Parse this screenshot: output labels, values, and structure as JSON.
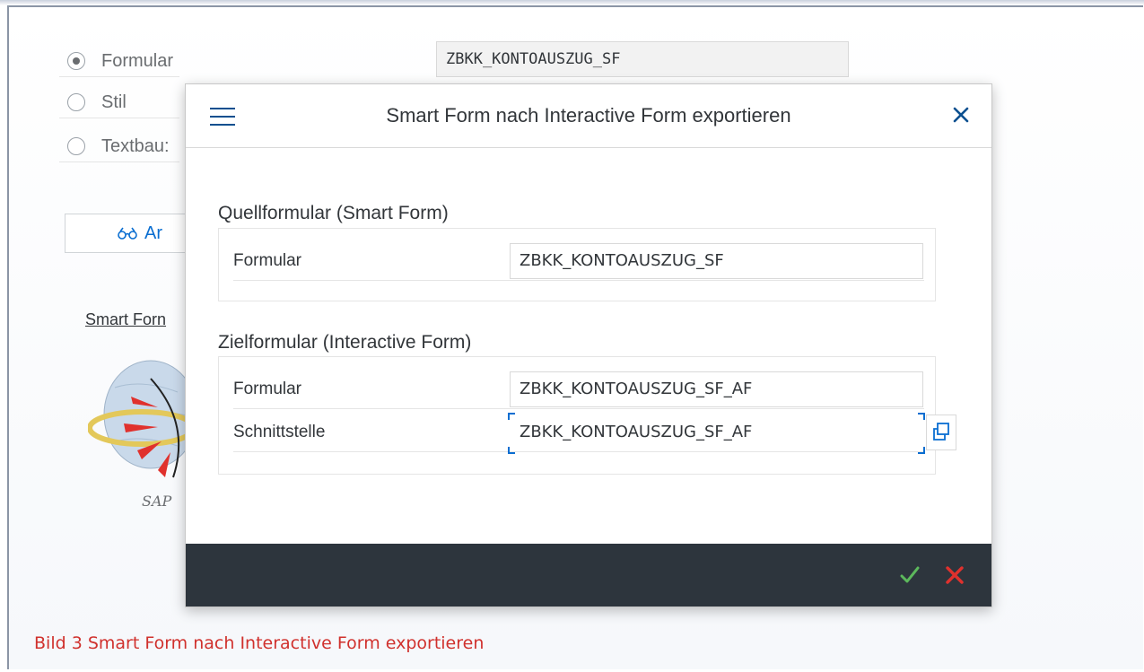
{
  "background": {
    "radio_options": [
      {
        "label": "Formular",
        "checked": true
      },
      {
        "label": "Stil",
        "checked": false
      },
      {
        "label": "Textbau:",
        "checked": false
      }
    ],
    "form_field_value": "ZBKK_KONTOAUSZUG_SF",
    "display_button_label": "Ar",
    "smart_forms_link": "Smart Forn",
    "logo_text": "SAP"
  },
  "dialog": {
    "title": "Smart Form nach Interactive Form exportieren",
    "source_group": {
      "title": "Quellformular (Smart Form)",
      "form_label": "Formular",
      "form_value": "ZBKK_KONTOAUSZUG_SF"
    },
    "target_group": {
      "title": "Zielformular (Interactive Form)",
      "form_label": "Formular",
      "form_value": "ZBKK_KONTOAUSZUG_SF_AF",
      "interface_label": "Schnittstelle",
      "interface_value": "ZBKK_KONTOAUSZUG_SF_AF"
    },
    "colors": {
      "footer_bg": "#2d353d",
      "ok": "#5cb85c",
      "cancel": "#e0312d",
      "accent": "#0a6ed1"
    }
  },
  "caption": "Bild 3 Smart Form nach Interactive Form exportieren"
}
